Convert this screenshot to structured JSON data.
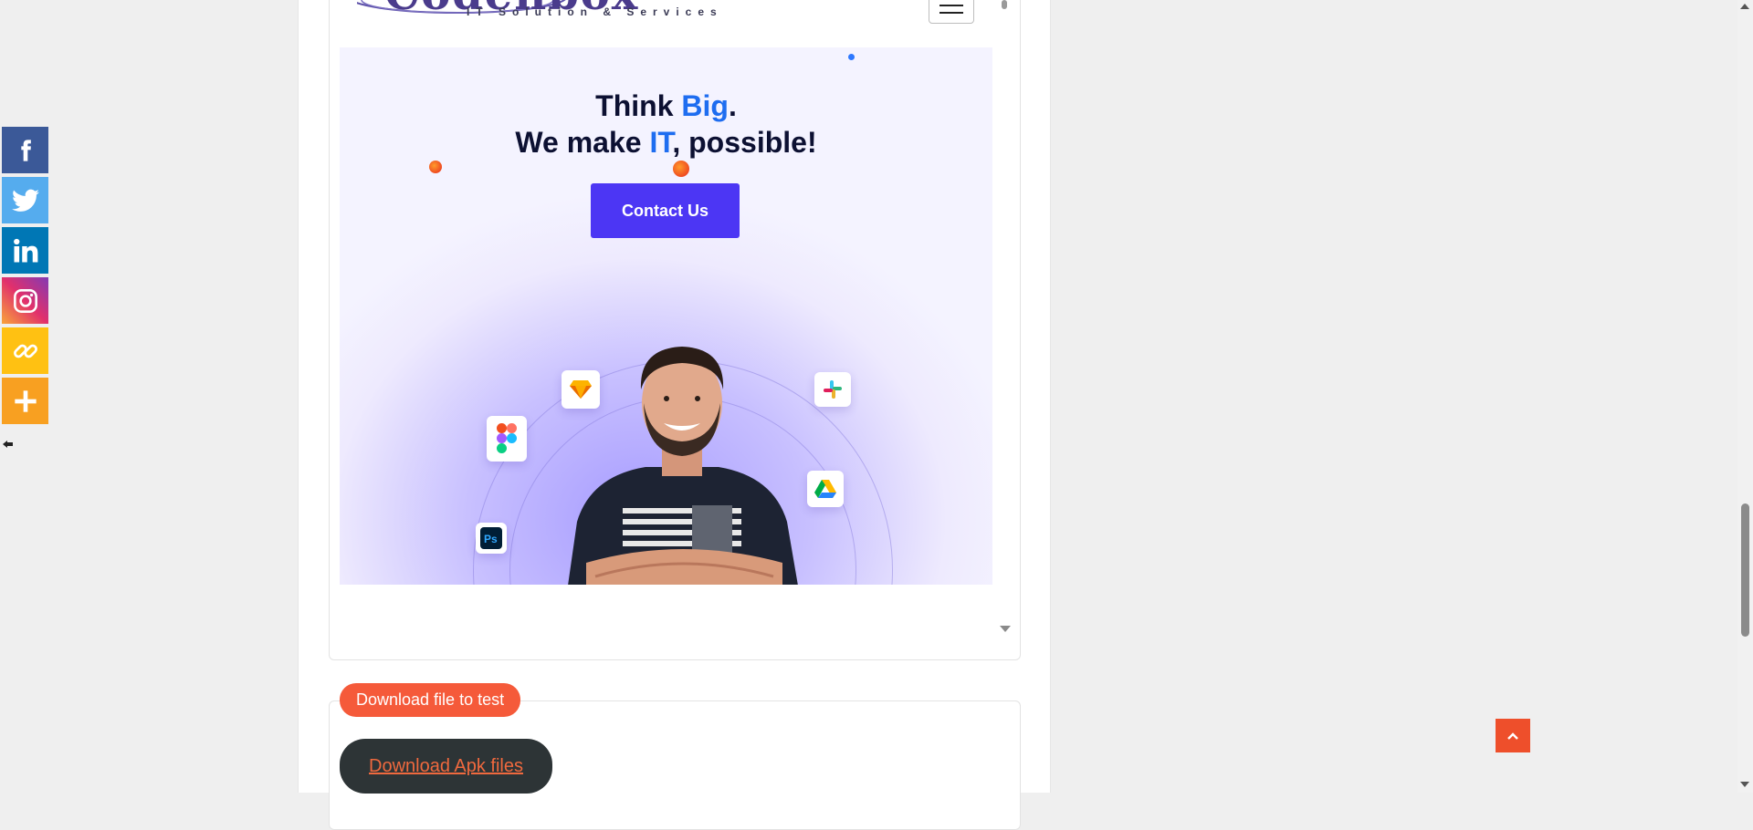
{
  "logo": {
    "name": "Codenbox",
    "tagline": "IT Solution & Services"
  },
  "hero": {
    "line1_pre": "Think ",
    "line1_accent": "Big",
    "line1_post": ".",
    "line2_pre": "We make ",
    "line2_accent": "IT",
    "line2_post": ", possible!",
    "cta_label": "Contact Us"
  },
  "downloads": {
    "badge_label": "Download file to test",
    "apk_label": "Download Apk files"
  },
  "share_bar": {
    "items": [
      {
        "network": "facebook",
        "color": "#3b5998"
      },
      {
        "network": "twitter",
        "color": "#55acee"
      },
      {
        "network": "linkedin",
        "color": "#0077b5"
      },
      {
        "network": "instagram",
        "color": "#c13584"
      },
      {
        "network": "copy-link",
        "color": "#ffc112"
      },
      {
        "network": "more",
        "color": "#f8a021"
      }
    ]
  },
  "colors": {
    "accent_blue": "#1e6df0",
    "cta_purple": "#4c36f4",
    "badge_orange": "#f55a3a",
    "back_to_top": "#ee4f2b"
  }
}
